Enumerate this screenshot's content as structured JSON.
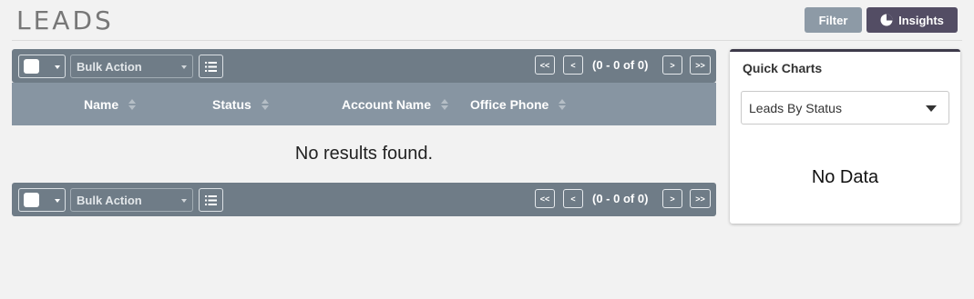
{
  "page": {
    "title": "LEADS"
  },
  "actions": {
    "filter_label": "Filter",
    "insights_label": "Insights"
  },
  "toolbar": {
    "bulk_action_label": "Bulk Action",
    "first_label": "<<",
    "prev_label": "<",
    "next_label": ">",
    "last_label": ">>",
    "page_count": "(0 - 0 of 0)"
  },
  "table": {
    "columns": [
      "Name",
      "Status",
      "Account Name",
      "Office Phone"
    ],
    "empty_message": "No results found."
  },
  "quick_charts": {
    "title": "Quick Charts",
    "selected_chart": "Leads By Status",
    "empty_message": "No Data"
  },
  "colors": {
    "toolbar": "#6f7c87",
    "header": "#8795a2",
    "filter_button": "#8d9aa6",
    "insights_button": "#534d64"
  }
}
